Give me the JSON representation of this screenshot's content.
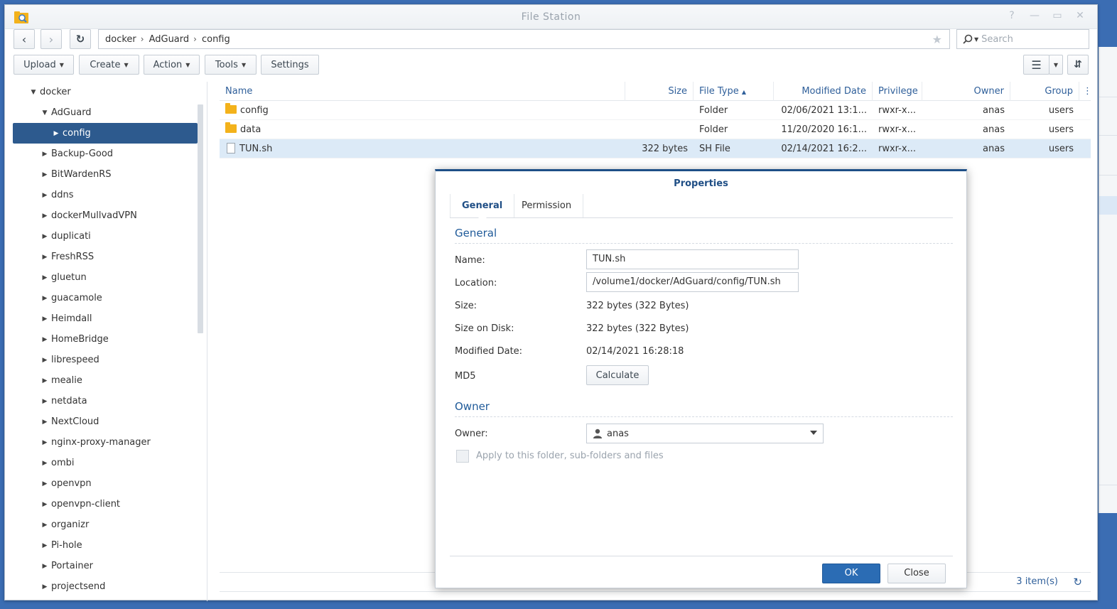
{
  "window": {
    "title": "File Station"
  },
  "breadcrumb": [
    "docker",
    "AdGuard",
    "config"
  ],
  "search": {
    "placeholder": "Search"
  },
  "toolbar": {
    "upload": "Upload",
    "create": "Create",
    "action": "Action",
    "tools": "Tools",
    "settings": "Settings"
  },
  "tree": [
    {
      "label": "docker",
      "level": 0,
      "expanded": true
    },
    {
      "label": "AdGuard",
      "level": 1,
      "expanded": true
    },
    {
      "label": "config",
      "level": 2,
      "selected": true
    },
    {
      "label": "Backup-Good",
      "level": 1
    },
    {
      "label": "BitWardenRS",
      "level": 1
    },
    {
      "label": "ddns",
      "level": 1
    },
    {
      "label": "dockerMullvadVPN",
      "level": 1
    },
    {
      "label": "duplicati",
      "level": 1
    },
    {
      "label": "FreshRSS",
      "level": 1
    },
    {
      "label": "gluetun",
      "level": 1
    },
    {
      "label": "guacamole",
      "level": 1
    },
    {
      "label": "Heimdall",
      "level": 1
    },
    {
      "label": "HomeBridge",
      "level": 1
    },
    {
      "label": "librespeed",
      "level": 1
    },
    {
      "label": "mealie",
      "level": 1
    },
    {
      "label": "netdata",
      "level": 1
    },
    {
      "label": "NextCloud",
      "level": 1
    },
    {
      "label": "nginx-proxy-manager",
      "level": 1
    },
    {
      "label": "ombi",
      "level": 1
    },
    {
      "label": "openvpn",
      "level": 1
    },
    {
      "label": "openvpn-client",
      "level": 1
    },
    {
      "label": "organizr",
      "level": 1
    },
    {
      "label": "Pi-hole",
      "level": 1
    },
    {
      "label": "Portainer",
      "level": 1
    },
    {
      "label": "projectsend",
      "level": 1
    }
  ],
  "columns": {
    "name": "Name",
    "size": "Size",
    "type": "File Type",
    "modified": "Modified Date",
    "privilege": "Privilege",
    "owner": "Owner",
    "group": "Group"
  },
  "files": [
    {
      "name": "config",
      "kind": "folder",
      "size": "",
      "type": "Folder",
      "modified": "02/06/2021 13:1...",
      "privilege": "rwxr-x...",
      "owner": "anas",
      "group": "users"
    },
    {
      "name": "data",
      "kind": "folder",
      "size": "",
      "type": "Folder",
      "modified": "11/20/2020 16:1...",
      "privilege": "rwxr-x...",
      "owner": "anas",
      "group": "users"
    },
    {
      "name": "TUN.sh",
      "kind": "file",
      "size": "322 bytes",
      "type": "SH File",
      "modified": "02/14/2021 16:2...",
      "privilege": "rwxr-x...",
      "owner": "anas",
      "group": "users",
      "selected": true
    }
  ],
  "status": {
    "items": "3 item(s)"
  },
  "dialog": {
    "title": "Properties",
    "tabs": [
      "General",
      "Permission"
    ],
    "section_general": "General",
    "name_label": "Name:",
    "name_value": "TUN.sh",
    "location_label": "Location:",
    "location_value": "/volume1/docker/AdGuard/config/TUN.sh",
    "size_label": "Size:",
    "size_value": "322 bytes (322 Bytes)",
    "disk_label": "Size on Disk:",
    "disk_value": "322 bytes (322 Bytes)",
    "modified_label": "Modified Date:",
    "modified_value": "02/14/2021 16:28:18",
    "md5_label": "MD5",
    "calculate": "Calculate",
    "section_owner": "Owner",
    "owner_label": "Owner:",
    "owner_value": "anas",
    "apply_label": "Apply to this folder, sub-folders and files",
    "ok": "OK",
    "close": "Close"
  }
}
